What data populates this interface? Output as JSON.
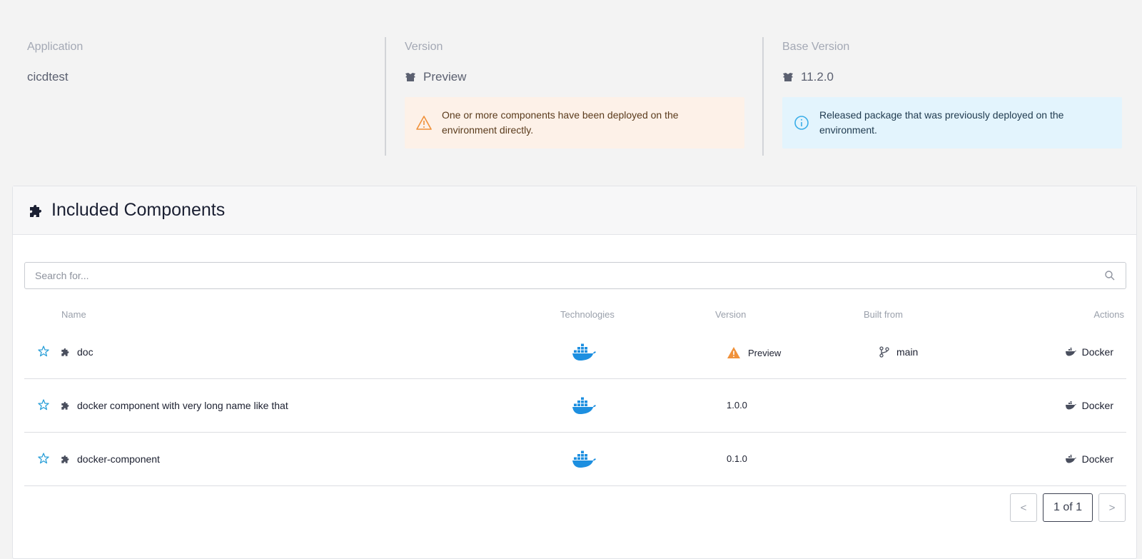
{
  "info": {
    "application": {
      "label": "Application",
      "value": "cicdtest"
    },
    "version": {
      "label": "Version",
      "value": "Preview",
      "alert": "One or more components have been deployed on the environment directly."
    },
    "base_version": {
      "label": "Base Version",
      "value": "11.2.0",
      "alert": "Released package that was previously deployed on the environment."
    }
  },
  "components": {
    "title": "Included Components",
    "search_placeholder": "Search for...",
    "columns": {
      "name": "Name",
      "technologies": "Technologies",
      "version": "Version",
      "built_from": "Built from",
      "actions": "Actions"
    },
    "rows": [
      {
        "name": "doc",
        "technology": "docker-icon",
        "version": "Preview",
        "version_warning": true,
        "built_from": "main",
        "action": "Docker"
      },
      {
        "name": "docker component with very long name like that",
        "technology": "docker-icon",
        "version": "1.0.0",
        "version_warning": false,
        "built_from": "",
        "action": "Docker"
      },
      {
        "name": "docker-component",
        "technology": "docker-icon",
        "version": "0.1.0",
        "version_warning": false,
        "built_from": "",
        "action": "Docker"
      }
    ],
    "pagination": {
      "prev": "<",
      "page": "1 of 1",
      "next": ">"
    }
  },
  "colors": {
    "warning": "#f0913a",
    "info": "#3aaee8",
    "star": "#2a9fd8",
    "docker": "#1d8fe0"
  }
}
